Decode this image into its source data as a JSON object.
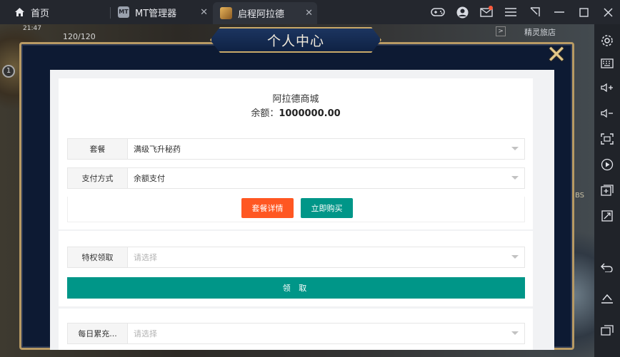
{
  "window": {
    "tabs": [
      {
        "label": "首页",
        "icon": "home-icon"
      },
      {
        "label": "MT管理器",
        "icon": "mt-manager-icon"
      },
      {
        "label": "启程阿拉德",
        "icon": "game-app-icon"
      }
    ],
    "controls": [
      "gamepad-icon",
      "account-icon",
      "mail-icon",
      "menu-icon",
      "popout-icon",
      "minimize-icon",
      "maximize-icon",
      "close-icon"
    ]
  },
  "sidebar": [
    "settings-icon",
    "keyboard-icon",
    "volume-up-icon",
    "volume-down-icon",
    "screenshot-icon",
    "record-icon",
    "add-app-icon",
    "resize-icon",
    "back-icon",
    "home-icon",
    "recent-apps-icon"
  ],
  "hud": {
    "time": "21:47",
    "hp": "120/120",
    "location": "精灵旅店",
    "badge": "1",
    "side_text": "BS"
  },
  "modal": {
    "title": "个人中心",
    "shop_name": "阿拉德商城",
    "balance_label": "余额：",
    "balance_value": "1000000.00",
    "package_label": "套餐",
    "package_value": "满级飞升秘药",
    "payment_label": "支付方式",
    "payment_value": "余额支付",
    "detail_button": "套餐详情",
    "buy_button": "立即购买",
    "privilege_label": "特权领取",
    "privilege_placeholder": "请选择",
    "claim_button": "领 取",
    "daily_label": "每日累充...",
    "daily_placeholder": "请选择"
  }
}
